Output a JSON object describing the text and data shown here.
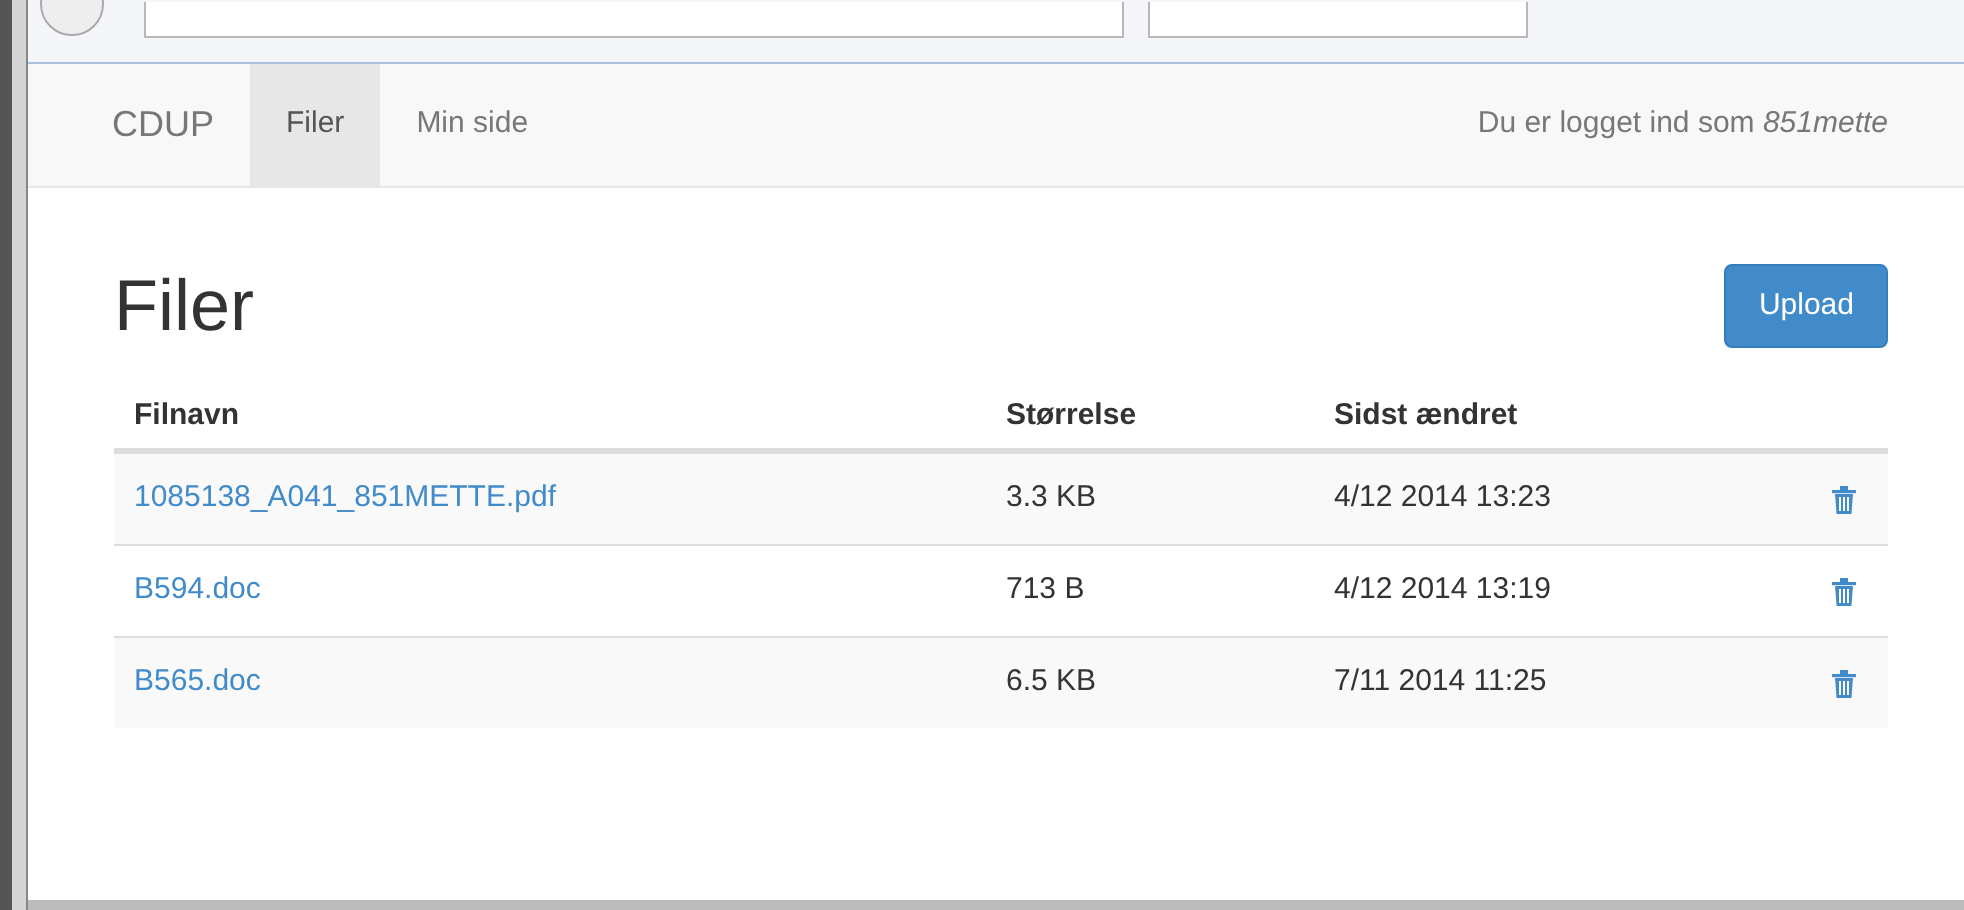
{
  "navbar": {
    "brand": "CDUP",
    "items": [
      {
        "label": "Filer",
        "selected": true
      },
      {
        "label": "Min side",
        "selected": false
      }
    ],
    "login_text": "Du er logget ind som *851mette*"
  },
  "page": {
    "title": "Filer",
    "upload_button": "Upload"
  },
  "table": {
    "columns": [
      "Filnavn",
      "Størrelse",
      "Sidst ændret"
    ],
    "rows": [
      {
        "name": "1085138_A041_851METTE.pdf",
        "size": "3.3 KB",
        "modified": "4/12 2014 13:23"
      },
      {
        "name": "B594.doc",
        "size": "713 B",
        "modified": "4/12 2014 13:19"
      },
      {
        "name": "B565.doc",
        "size": "6.5 KB",
        "modified": "7/11 2014 11:25"
      }
    ]
  }
}
